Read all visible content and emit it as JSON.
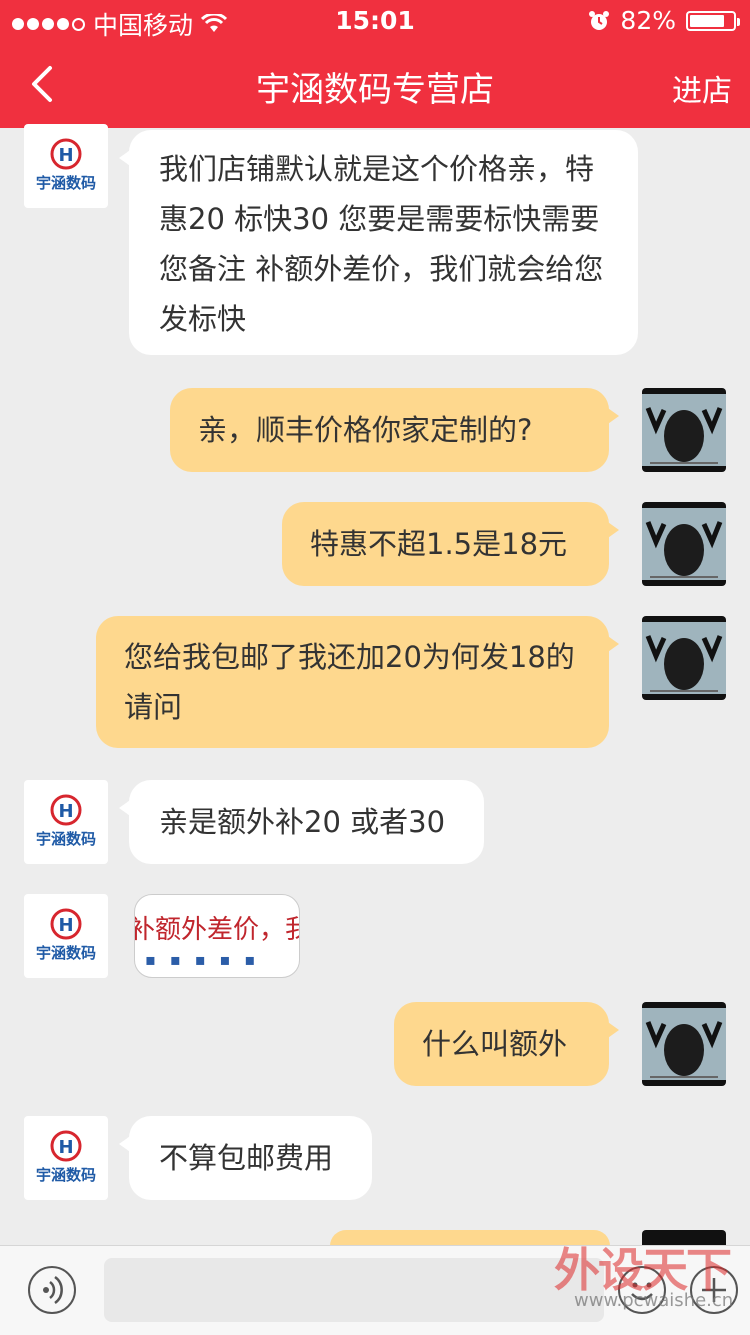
{
  "status_bar": {
    "carrier": "中国移动",
    "time": "15:01",
    "battery_percent": "82%",
    "battery_level": 0.82
  },
  "nav": {
    "title": "宇涵数码专营店",
    "enter_label": "进店"
  },
  "shop_logo_text": "宇涵数码",
  "messages": [
    {
      "side": "left",
      "text": "我们店铺默认就是这个价格亲，特惠20 标快30 您要是需要标快需要您备注 补额外差价，我们就会给您发标快"
    },
    {
      "side": "right",
      "text": "亲，顺丰价格你家定制的?"
    },
    {
      "side": "right",
      "text": "特惠不超1.5是18元"
    },
    {
      "side": "right",
      "text": "您给我包邮了我还加20为何发18的请问"
    },
    {
      "side": "left",
      "text": "亲是额外补20 或者30"
    },
    {
      "side": "left",
      "type": "image",
      "text": "补额外差价，我"
    },
    {
      "side": "right",
      "text": "什么叫额外"
    },
    {
      "side": "left",
      "text": "不算包邮费用"
    }
  ],
  "watermark": {
    "main": "外设天下",
    "url": "www.pcwaishe.cn"
  },
  "colors": {
    "header": "#f0303f",
    "bubble_self": "#fed88e",
    "bubble_other": "#ffffff",
    "background": "#ededed"
  }
}
